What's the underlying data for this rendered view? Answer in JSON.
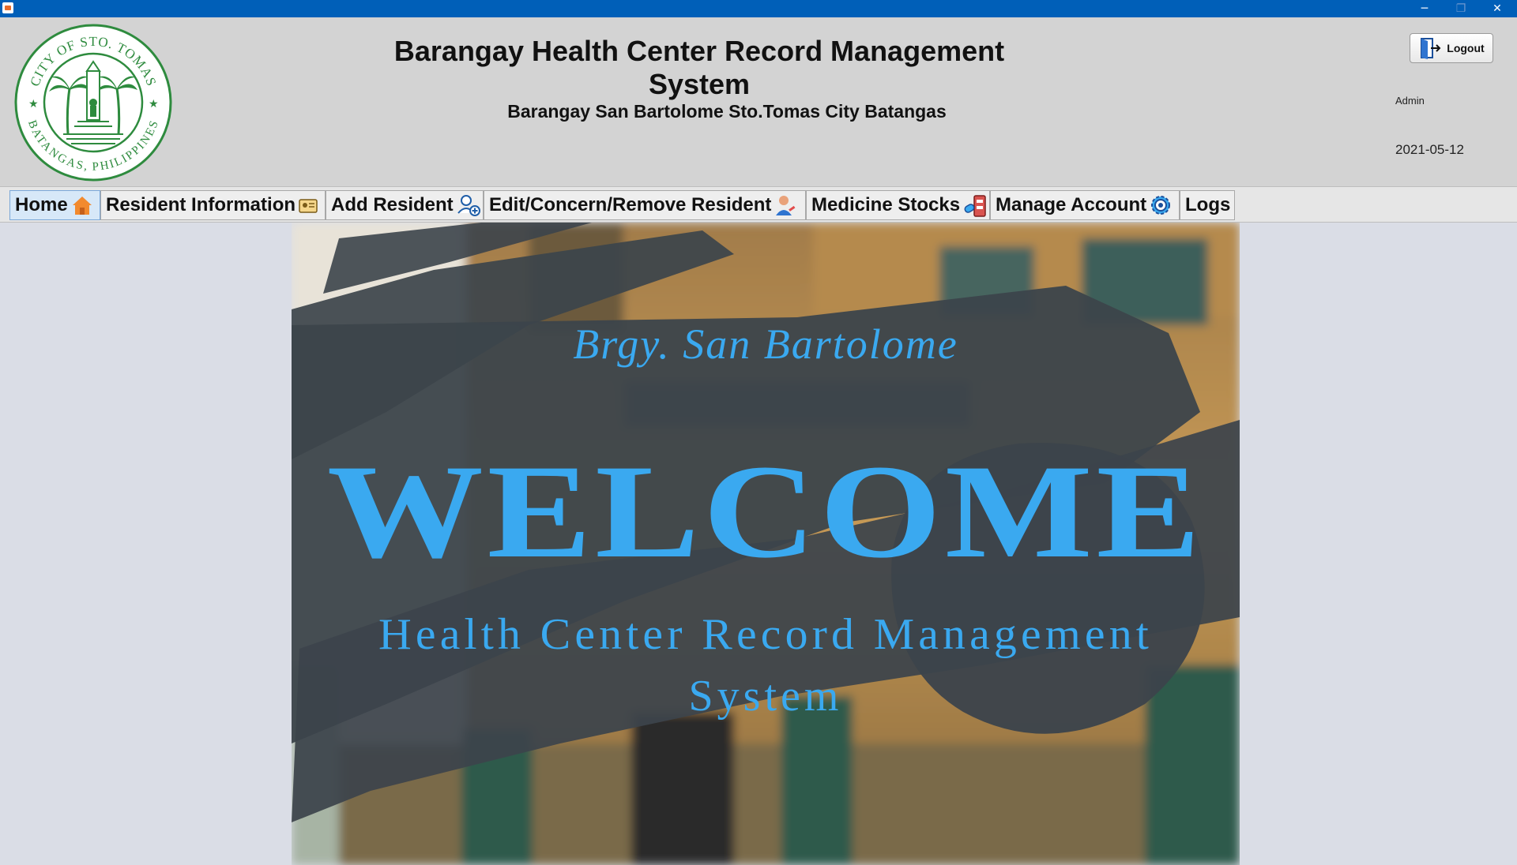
{
  "window": {
    "minimize_glyph": "─",
    "restore_glyph": "❐",
    "close_glyph": "✕"
  },
  "header": {
    "seal_top_text": "CITY OF STO. TOMAS",
    "seal_bottom_text": "BATANGAS, PHILIPPINES",
    "title": "Barangay Health Center Record Management System",
    "subtitle": "Barangay San Bartolome Sto.Tomas City Batangas",
    "logout_label": "Logout",
    "user": "Admin",
    "date": "2021-05-12"
  },
  "tabs": [
    {
      "label": "Home",
      "icon": "house-icon",
      "active": true
    },
    {
      "label": "Resident Information",
      "icon": "id-card-icon",
      "active": false
    },
    {
      "label": "Add Resident",
      "icon": "add-user-icon",
      "active": false
    },
    {
      "label": "Edit/Concern/Remove Resident",
      "icon": "user-edit-icon",
      "active": false
    },
    {
      "label": "Medicine Stocks",
      "icon": "medicine-icon",
      "active": false
    },
    {
      "label": "Manage Account",
      "icon": "gear-icon",
      "active": false
    },
    {
      "label": "Logs",
      "icon": "",
      "active": false
    }
  ],
  "banner": {
    "line1": "Brgy. San Bartolome",
    "welcome": "WELCOME",
    "line3": "Health Center Record Management",
    "line4": "System"
  },
  "colors": {
    "titlebar": "#005fb8",
    "accent_blue": "#3aa9f0",
    "brush_dark": "#3c444b"
  }
}
